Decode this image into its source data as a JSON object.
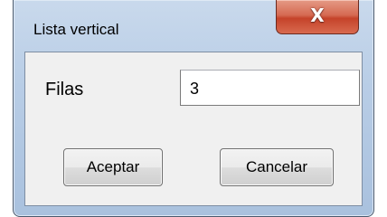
{
  "window": {
    "title": "Lista vertical",
    "close_glyph": "X"
  },
  "form": {
    "rows_label": "Filas",
    "rows_value": "3"
  },
  "buttons": {
    "accept": "Aceptar",
    "cancel": "Cancelar"
  }
}
